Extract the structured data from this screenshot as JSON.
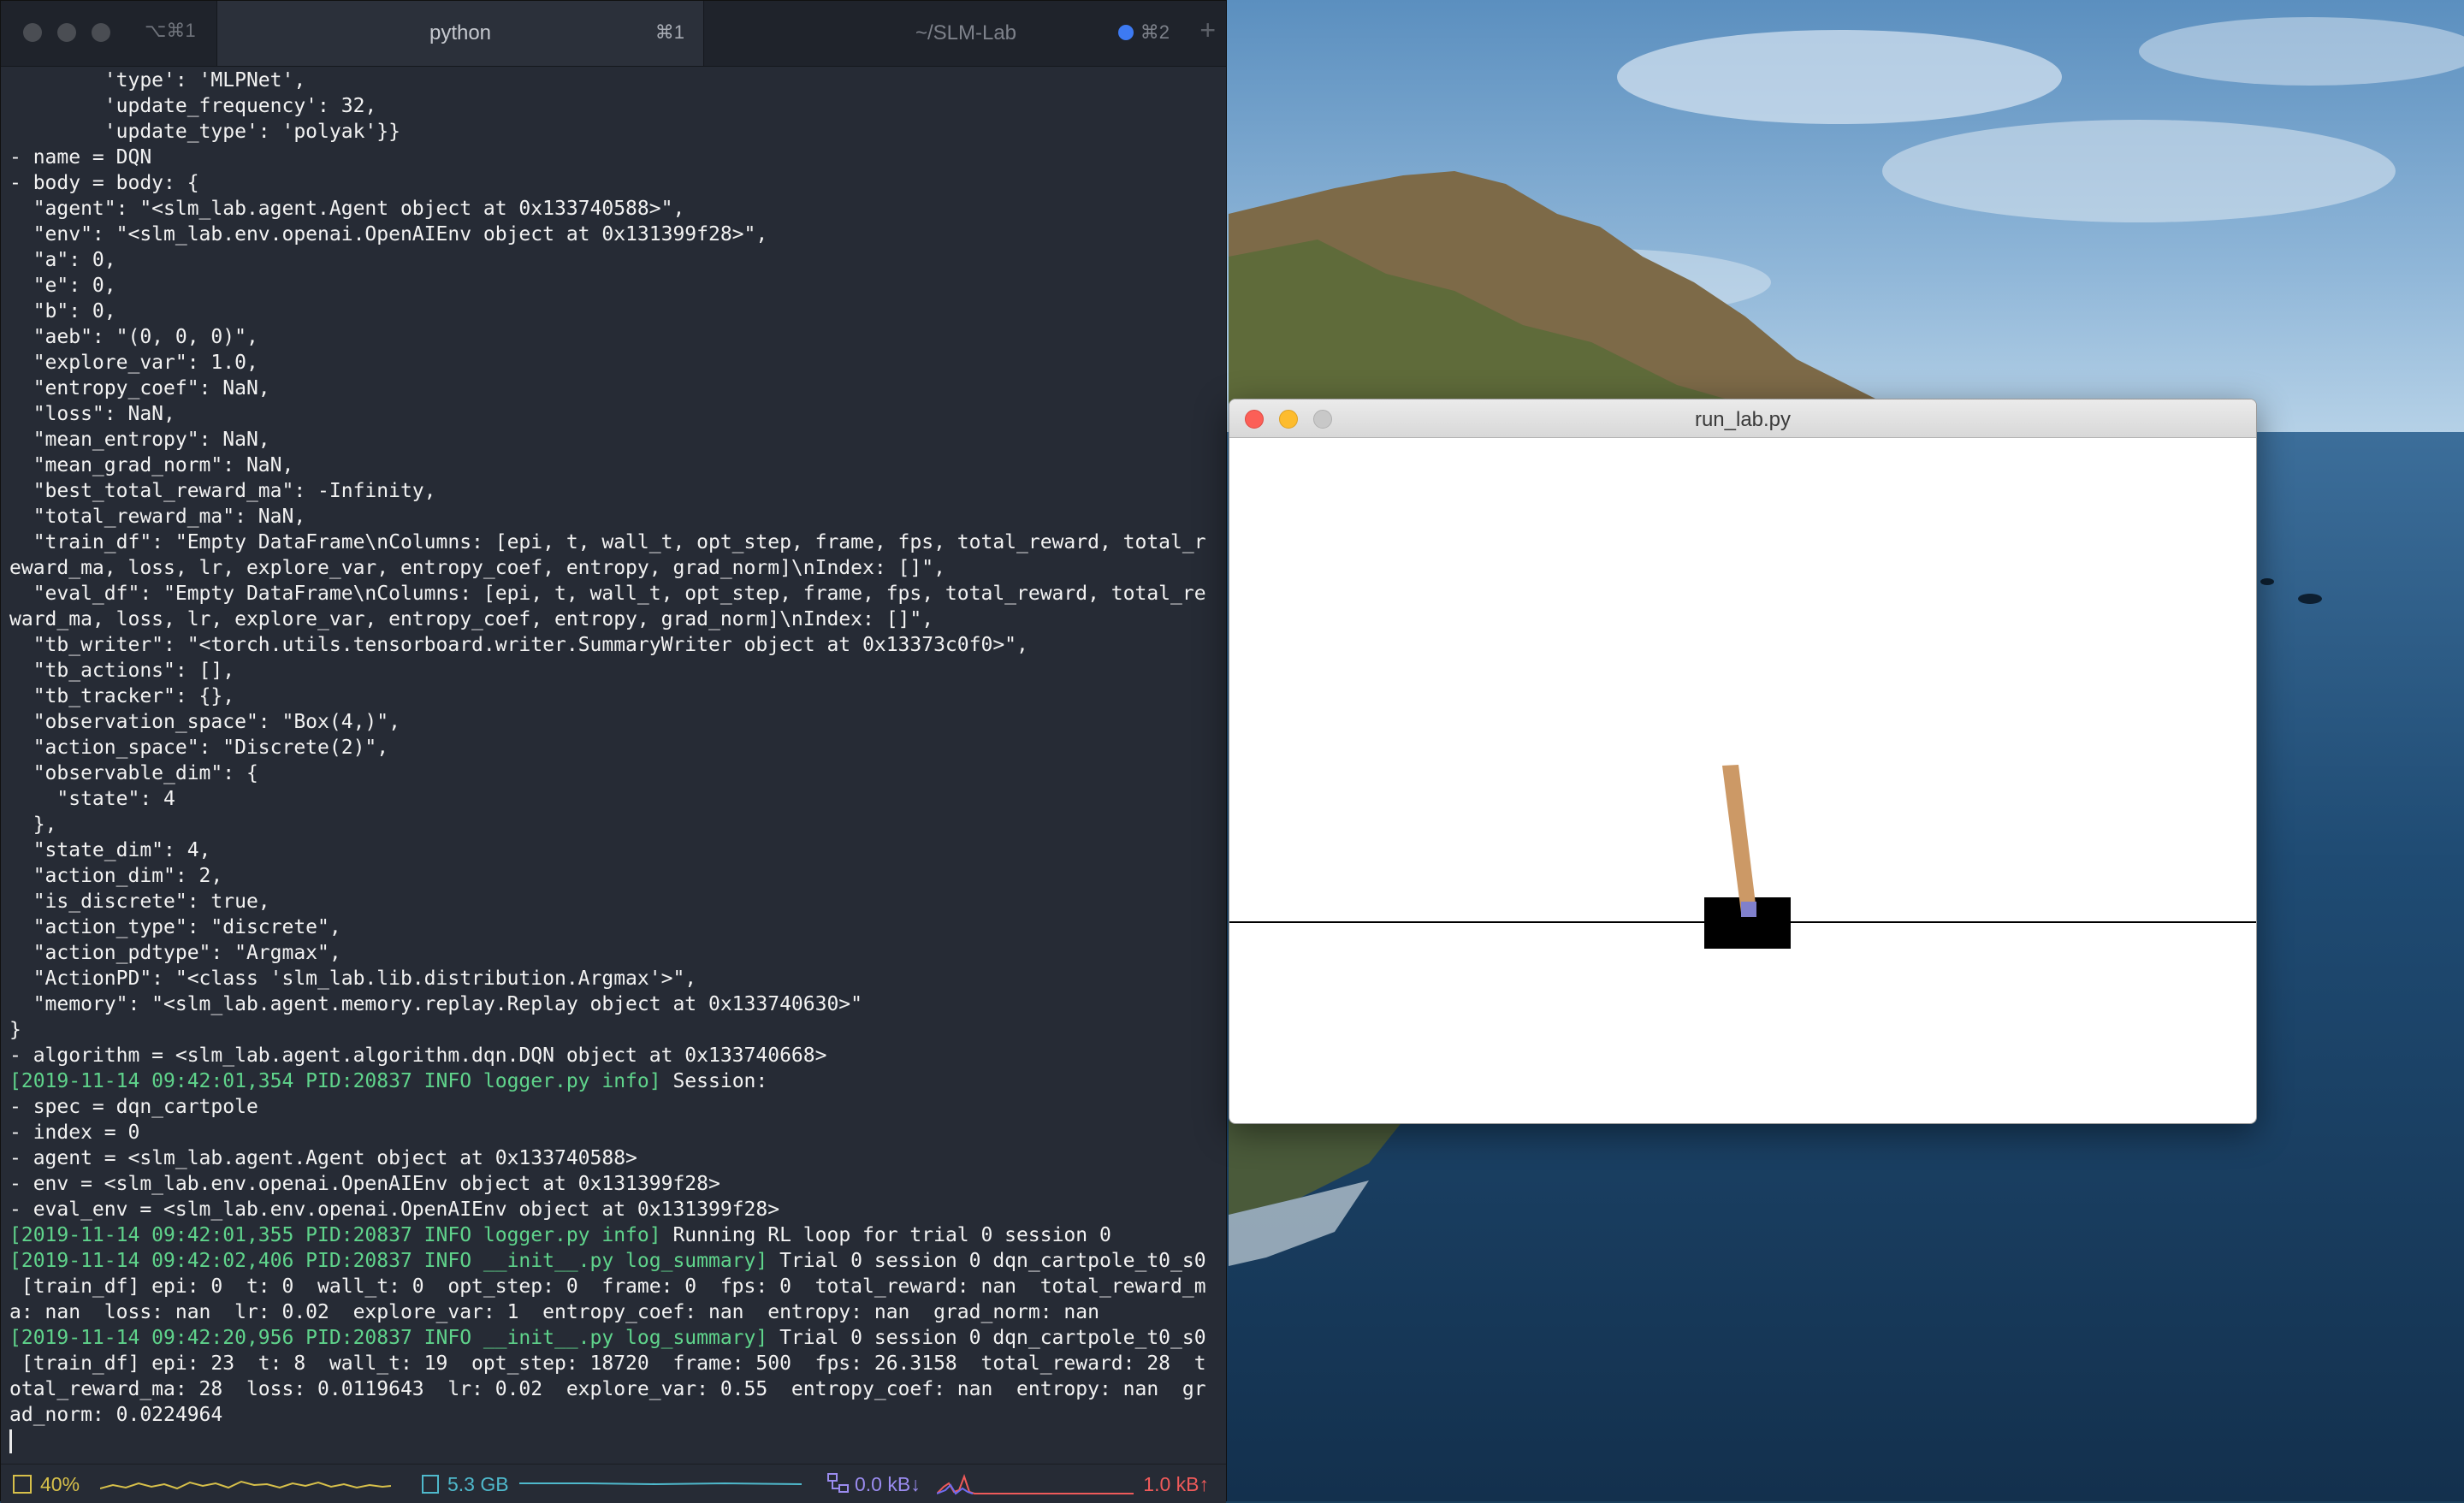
{
  "terminal": {
    "tab_shortcut_main": "⌥⌘1",
    "tabs": [
      {
        "title": "python",
        "shortcut": "⌘1"
      },
      {
        "title": "~/SLM-Lab",
        "shortcut": "⌘2"
      }
    ],
    "lines": [
      {
        "text": "        'type': 'MLPNet',",
        "style": "plain"
      },
      {
        "text": "        'update_frequency': 32,",
        "style": "plain"
      },
      {
        "text": "        'update_type': 'polyak'}}",
        "style": "plain"
      },
      {
        "text": "- name = DQN",
        "style": "plain"
      },
      {
        "text": "- body = body: {",
        "style": "plain"
      },
      {
        "text": "  \"agent\": \"<slm_lab.agent.Agent object at 0x133740588>\",",
        "style": "plain"
      },
      {
        "text": "  \"env\": \"<slm_lab.env.openai.OpenAIEnv object at 0x131399f28>\",",
        "style": "plain"
      },
      {
        "text": "  \"a\": 0,",
        "style": "plain"
      },
      {
        "text": "  \"e\": 0,",
        "style": "plain"
      },
      {
        "text": "  \"b\": 0,",
        "style": "plain"
      },
      {
        "text": "  \"aeb\": \"(0, 0, 0)\",",
        "style": "plain"
      },
      {
        "text": "  \"explore_var\": 1.0,",
        "style": "plain"
      },
      {
        "text": "  \"entropy_coef\": NaN,",
        "style": "plain"
      },
      {
        "text": "  \"loss\": NaN,",
        "style": "plain"
      },
      {
        "text": "  \"mean_entropy\": NaN,",
        "style": "plain"
      },
      {
        "text": "  \"mean_grad_norm\": NaN,",
        "style": "plain"
      },
      {
        "text": "  \"best_total_reward_ma\": -Infinity,",
        "style": "plain"
      },
      {
        "text": "  \"total_reward_ma\": NaN,",
        "style": "plain"
      },
      {
        "text": "  \"train_df\": \"Empty DataFrame\\nColumns: [epi, t, wall_t, opt_step, frame, fps, total_reward, total_r",
        "style": "plain"
      },
      {
        "text": "eward_ma, loss, lr, explore_var, entropy_coef, entropy, grad_norm]\\nIndex: []\",",
        "style": "plain"
      },
      {
        "text": "  \"eval_df\": \"Empty DataFrame\\nColumns: [epi, t, wall_t, opt_step, frame, fps, total_reward, total_re",
        "style": "plain"
      },
      {
        "text": "ward_ma, loss, lr, explore_var, entropy_coef, entropy, grad_norm]\\nIndex: []\",",
        "style": "plain"
      },
      {
        "text": "  \"tb_writer\": \"<torch.utils.tensorboard.writer.SummaryWriter object at 0x13373c0f0>\",",
        "style": "plain"
      },
      {
        "text": "  \"tb_actions\": [],",
        "style": "plain"
      },
      {
        "text": "  \"tb_tracker\": {},",
        "style": "plain"
      },
      {
        "text": "  \"observation_space\": \"Box(4,)\",",
        "style": "plain"
      },
      {
        "text": "  \"action_space\": \"Discrete(2)\",",
        "style": "plain"
      },
      {
        "text": "  \"observable_dim\": {",
        "style": "plain"
      },
      {
        "text": "    \"state\": 4",
        "style": "plain"
      },
      {
        "text": "  },",
        "style": "plain"
      },
      {
        "text": "  \"state_dim\": 4,",
        "style": "plain"
      },
      {
        "text": "  \"action_dim\": 2,",
        "style": "plain"
      },
      {
        "text": "  \"is_discrete\": true,",
        "style": "plain"
      },
      {
        "text": "  \"action_type\": \"discrete\",",
        "style": "plain"
      },
      {
        "text": "  \"action_pdtype\": \"Argmax\",",
        "style": "plain"
      },
      {
        "text": "  \"ActionPD\": \"<class 'slm_lab.lib.distribution.Argmax'>\",",
        "style": "plain"
      },
      {
        "text": "  \"memory\": \"<slm_lab.agent.memory.replay.Replay object at 0x133740630>\"",
        "style": "plain"
      },
      {
        "text": "}",
        "style": "plain"
      },
      {
        "text": "- algorithm = <slm_lab.agent.algorithm.dqn.DQN object at 0x133740668>",
        "style": "plain"
      },
      {
        "text": "[2019-11-14 09:42:01,354 PID:20837 INFO logger.py info]",
        "rest": " Session:",
        "style": "log"
      },
      {
        "text": "- spec = dqn_cartpole",
        "style": "plain"
      },
      {
        "text": "- index = 0",
        "style": "plain"
      },
      {
        "text": "- agent = <slm_lab.agent.Agent object at 0x133740588>",
        "style": "plain"
      },
      {
        "text": "- env = <slm_lab.env.openai.OpenAIEnv object at 0x131399f28>",
        "style": "plain"
      },
      {
        "text": "- eval_env = <slm_lab.env.openai.OpenAIEnv object at 0x131399f28>",
        "style": "plain"
      },
      {
        "text": "[2019-11-14 09:42:01,355 PID:20837 INFO logger.py info]",
        "rest": " Running RL loop for trial 0 session 0",
        "style": "log"
      },
      {
        "text": "[2019-11-14 09:42:02,406 PID:20837 INFO __init__.py log_summary]",
        "rest": " Trial 0 session 0 dqn_cartpole_t0_s0",
        "style": "log"
      },
      {
        "text": " [train_df] epi: 0  t: 0  wall_t: 0  opt_step: 0  frame: 0  fps: 0  total_reward: nan  total_reward_m",
        "style": "plain"
      },
      {
        "text": "a: nan  loss: nan  lr: 0.02  explore_var: 1  entropy_coef: nan  entropy: nan  grad_norm: nan",
        "style": "plain"
      },
      {
        "text": "[2019-11-14 09:42:20,956 PID:20837 INFO __init__.py log_summary]",
        "rest": " Trial 0 session 0 dqn_cartpole_t0_s0",
        "style": "log"
      },
      {
        "text": " [train_df] epi: 23  t: 8  wall_t: 19  opt_step: 18720  frame: 500  fps: 26.3158  total_reward: 28  t",
        "style": "plain"
      },
      {
        "text": "otal_reward_ma: 28  loss: 0.0119643  lr: 0.02  explore_var: 0.55  entropy_coef: nan  entropy: nan  gr",
        "style": "plain"
      },
      {
        "text": "ad_norm: 0.0224964",
        "style": "plain"
      }
    ],
    "status": {
      "cpu": "40%",
      "memory": "5.3 GB",
      "net_down": "0.0 kB↓",
      "net_up": "1.0 kB↑"
    },
    "colors": {
      "background": "#262b35",
      "log_prefix": "#5fd38b",
      "cpu": "#d7c04a",
      "memory": "#4fb9cc",
      "net_down": "#9b8cf0",
      "net_up": "#ef5a5a"
    }
  },
  "gym_window": {
    "title": "run_lab.py",
    "scene": {
      "cart_color": "#000000",
      "pole_color": "#cc9966",
      "axle_color": "#8080cc",
      "track_color": "#000000"
    }
  }
}
